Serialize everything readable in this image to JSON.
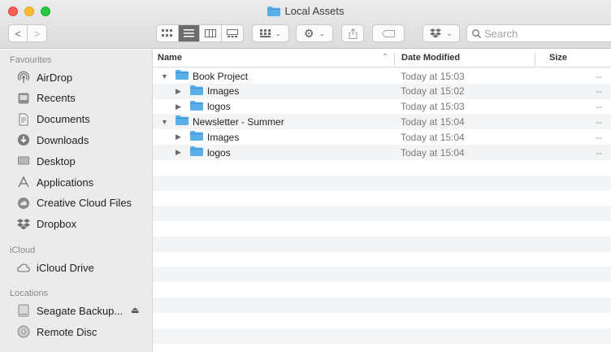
{
  "window": {
    "title": "Local Assets"
  },
  "toolbar": {
    "back_label": "<",
    "forward_label": ">",
    "action_label": "⚙",
    "search_placeholder": "Search"
  },
  "sidebar": {
    "favourites_header": "Favourites",
    "favourites": [
      {
        "label": "AirDrop",
        "icon": "airdrop-icon"
      },
      {
        "label": "Recents",
        "icon": "recents-icon"
      },
      {
        "label": "Documents",
        "icon": "documents-icon"
      },
      {
        "label": "Downloads",
        "icon": "downloads-icon"
      },
      {
        "label": "Desktop",
        "icon": "desktop-icon"
      },
      {
        "label": "Applications",
        "icon": "applications-icon"
      },
      {
        "label": "Creative Cloud Files",
        "icon": "creative-cloud-icon"
      },
      {
        "label": "Dropbox",
        "icon": "dropbox-icon"
      }
    ],
    "icloud_header": "iCloud",
    "icloud": [
      {
        "label": "iCloud Drive",
        "icon": "cloud-icon"
      }
    ],
    "locations_header": "Locations",
    "locations": [
      {
        "label": "Seagate Backup...",
        "icon": "drive-icon"
      },
      {
        "label": "Remote Disc",
        "icon": "disc-icon"
      }
    ]
  },
  "list": {
    "columns": {
      "name": "Name",
      "date": "Date Modified",
      "size": "Size"
    },
    "rows": [
      {
        "name": "Book Project",
        "date": "Today at 15:03",
        "size": "--",
        "level": 0,
        "expanded": true
      },
      {
        "name": "Images",
        "date": "Today at 15:02",
        "size": "--",
        "level": 1,
        "expanded": false
      },
      {
        "name": "logos",
        "date": "Today at 15:03",
        "size": "--",
        "level": 1,
        "expanded": false
      },
      {
        "name": "Newsletter - Summer",
        "date": "Today at 15:04",
        "size": "--",
        "level": 0,
        "expanded": true
      },
      {
        "name": "Images",
        "date": "Today at 15:04",
        "size": "--",
        "level": 1,
        "expanded": false
      },
      {
        "name": "logos",
        "date": "Today at 15:04",
        "size": "--",
        "level": 1,
        "expanded": false
      }
    ]
  },
  "colors": {
    "folder": "#5aafe8",
    "folder_dark": "#3f95d3",
    "sidebar_bg": "#ecebeb",
    "row_alt": "#f3f4f6"
  }
}
